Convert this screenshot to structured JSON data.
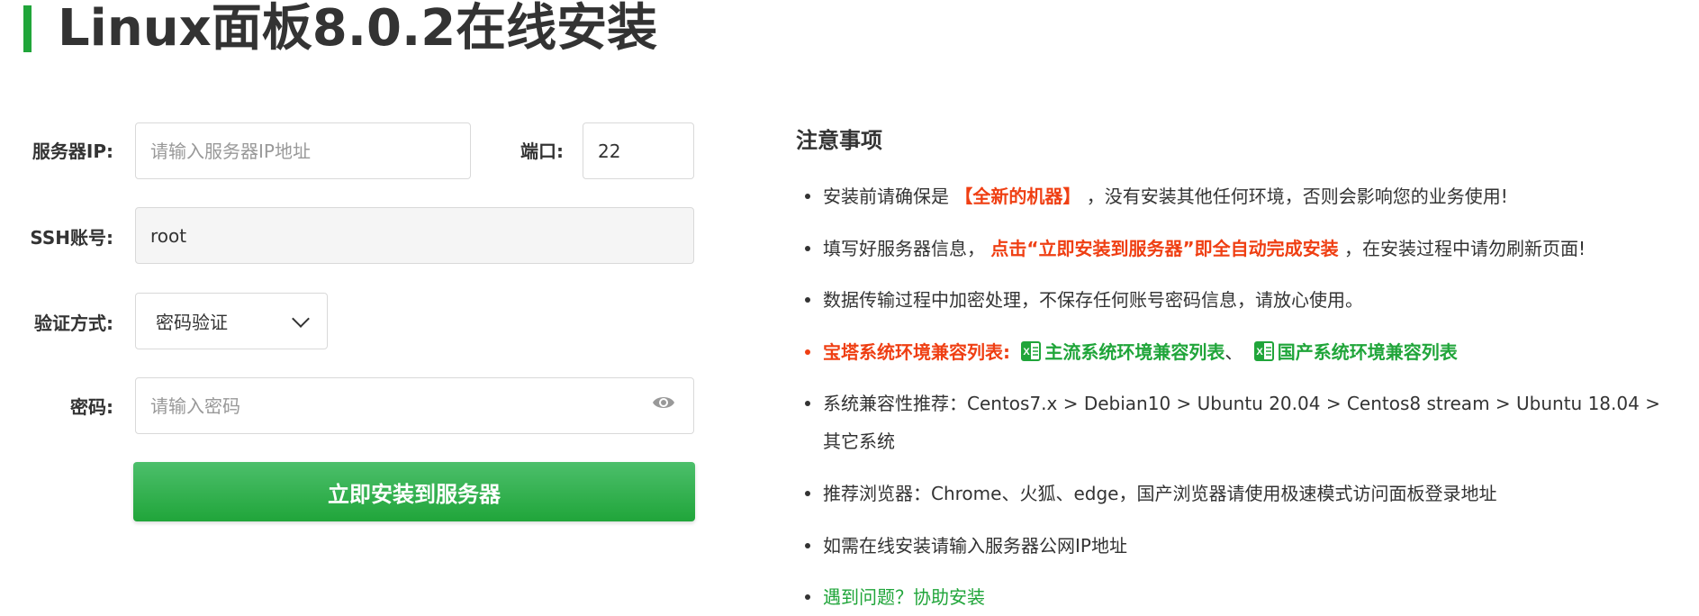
{
  "page": {
    "title": "Linux面板8.0.2在线安装"
  },
  "form": {
    "server_ip_label": "服务器IP:",
    "server_ip_placeholder": "请输入服务器IP地址",
    "port_label": "端口:",
    "port_value": "22",
    "ssh_label": "SSH账号:",
    "ssh_value": "root",
    "auth_label": "验证方式:",
    "auth_value": "密码验证",
    "password_label": "密码:",
    "password_placeholder": "请输入密码",
    "install_button": "立即安装到服务器"
  },
  "notes": {
    "title": "注意事项",
    "item1": {
      "a": "安装前请确保是",
      "b": "【全新的机器】",
      "c": "，没有安装其他任何环境，否则会影响您的业务使用!"
    },
    "item2": {
      "a": "填写好服务器信息，",
      "b": "点击“立即安装到服务器”即全自动完成安装",
      "c": "，在安装过程中请勿刷新页面!"
    },
    "item3": "数据传输过程中加密处理，不保存任何账号密码信息，请放心使用。",
    "item4": {
      "a": "宝塔系统环境兼容列表:",
      "b": "主流系统环境兼容列表",
      "sep": "、",
      "c": "国产系统环境兼容列表"
    },
    "item5": "系统兼容性推荐：Centos7.x > Debian10 > Ubuntu 20.04 > Centos8 stream > Ubuntu 18.04 > 其它系统",
    "item6": "推荐浏览器：Chrome、火狐、edge，国产浏览器请使用极速模式访问面板登录地址",
    "item7": "如需在线安装请输入服务器公网IP地址",
    "item8": "遇到问题？协助安装"
  },
  "colors": {
    "accent_green": "#20a53a",
    "highlight_red": "#ef3f13"
  }
}
